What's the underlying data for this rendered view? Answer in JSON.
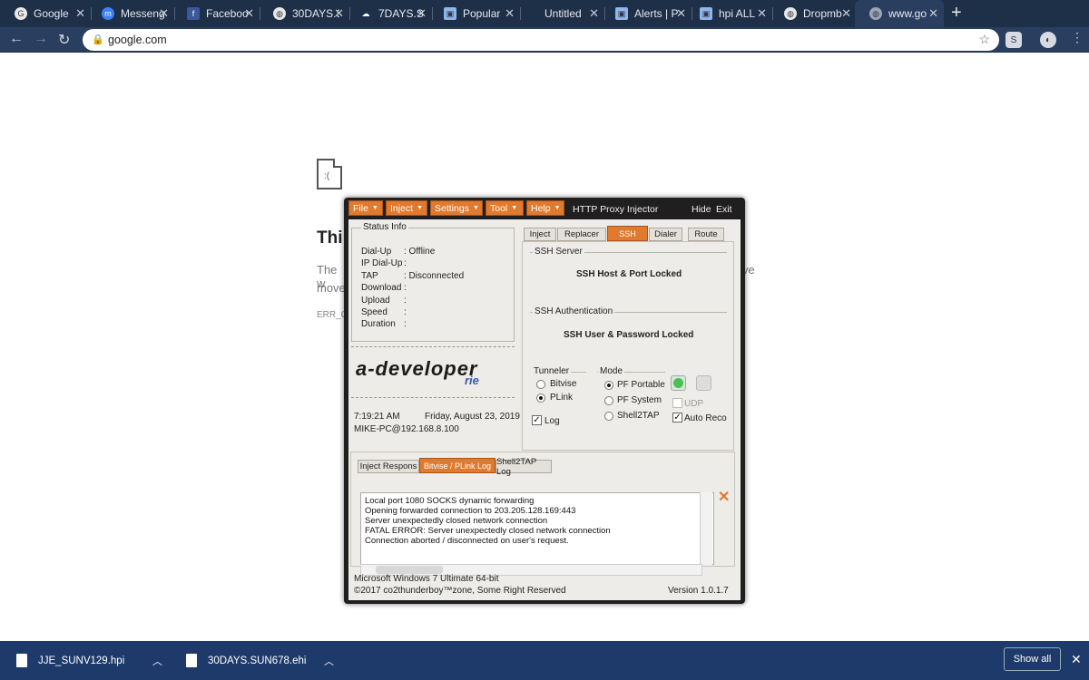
{
  "browser": {
    "tabs": [
      {
        "label": "Google",
        "icon": "google-icon"
      },
      {
        "label": "Messeng",
        "icon": "messenger-icon"
      },
      {
        "label": "Faceboo",
        "icon": "facebook-icon"
      },
      {
        "label": "30DAYS.S",
        "icon": "globe-icon"
      },
      {
        "label": "7DAYS.S",
        "icon": "cloud-icon"
      },
      {
        "label": "Popular",
        "icon": "app-icon"
      },
      {
        "label": "Untitled",
        "icon": "blank-icon"
      },
      {
        "label": "Alerts | P",
        "icon": "app-icon"
      },
      {
        "label": "hpi ALL",
        "icon": "app-icon"
      },
      {
        "label": "Dropmb",
        "icon": "globe-icon"
      },
      {
        "label": "www.go",
        "icon": "globe-icon"
      }
    ],
    "url": "google.com"
  },
  "error_page": {
    "title": "Thi",
    "line1": "The w",
    "line2": "move",
    "line_tail": "ve",
    "code": "ERR_Q"
  },
  "app": {
    "title": "HTTP Proxy Injector",
    "hide": "Hide",
    "exit": "Exit",
    "menus": [
      "File",
      "Inject",
      "Settings",
      "Tool",
      "Help"
    ],
    "status": {
      "heading": "Status Info",
      "rows": [
        {
          "label": "Dial-Up",
          "value": ": Offline"
        },
        {
          "label": "IP Dial-Up",
          "value": ":"
        },
        {
          "label": "TAP",
          "value": ": Disconnected"
        },
        {
          "label": "Download",
          "value": ":"
        },
        {
          "label": "Upload",
          "value": ":"
        },
        {
          "label": "Speed",
          "value": ":"
        },
        {
          "label": "Duration",
          "value": ":"
        }
      ]
    },
    "logo": "a-developer",
    "logo_sub": "rie",
    "time": "7:19:21 AM",
    "date": "Friday, August 23, 2019",
    "host": "MIKE-PC@192.168.8.100",
    "top_tabs": [
      "Inject",
      "Replacer",
      "SSH",
      "Dialer",
      "Route"
    ],
    "ssh_server": {
      "heading": "SSH Server",
      "text": "SSH Host & Port Locked"
    },
    "ssh_auth": {
      "heading": "SSH Authentication",
      "text": "SSH User & Password Locked"
    },
    "tunneler": {
      "heading": "Tunneler",
      "options": [
        "Bitvise",
        "PLink"
      ],
      "selected": "PLink",
      "log_label": "Log"
    },
    "mode": {
      "heading": "Mode",
      "options": [
        "PF Portable",
        "PF System",
        "Shell2TAP"
      ],
      "selected": "PF Portable",
      "udp_label": "UDP",
      "autoreco_label": "Auto Reco"
    },
    "log_tabs": [
      "Inject Respons",
      "Bitvise / PLink Log",
      "Shell2TAP Log"
    ],
    "log_lines": [
      "Local port 1080 SOCKS dynamic forwarding",
      "Opening forwarded connection to 203.205.128.169:443",
      "Server unexpectedly closed network connection",
      "FATAL ERROR: Server unexpectedly closed network connection",
      "Connection aborted / disconnected on user's request."
    ],
    "footer_os": "Microsoft Windows 7 Ultimate  64-bit",
    "footer_copy": "©2017 co2thunderboy™zone, Some Right Reserved",
    "version": "Version 1.0.1.7"
  },
  "downloads": {
    "items": [
      "JJE_SUNV129.hpi",
      "30DAYS.SUN678.ehi"
    ],
    "show_all": "Show all"
  }
}
